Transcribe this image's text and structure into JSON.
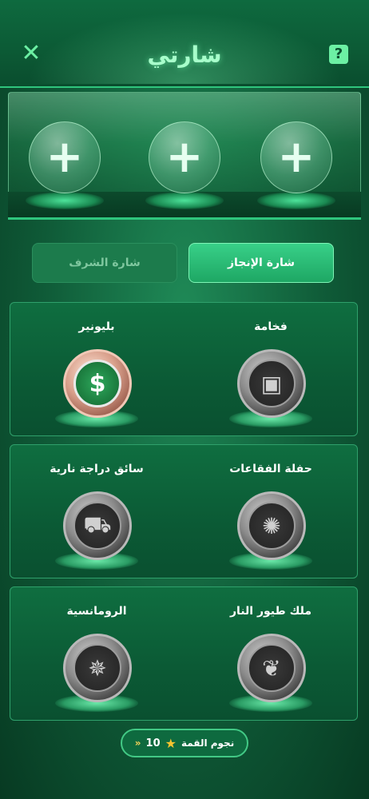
{
  "header": {
    "title": "شارتي",
    "close_icon": "✕",
    "help_icon": "?"
  },
  "display_slots": [
    {
      "icon": "+"
    },
    {
      "icon": "+"
    },
    {
      "icon": "+"
    }
  ],
  "tabs": [
    {
      "label": "شارة الإنجاز",
      "active": true
    },
    {
      "label": "شارة الشرف",
      "active": false
    }
  ],
  "badges": [
    {
      "name": "فخامة",
      "icon": "treasure-chest-icon",
      "glyph": "▣"
    },
    {
      "name": "بليونير",
      "icon": "dollar-icon",
      "glyph": "$"
    },
    {
      "name": "حفلة الفقاعات",
      "icon": "bubble-gun-icon",
      "glyph": "✺"
    },
    {
      "name": "سائق دراجة نارية",
      "icon": "motorcycle-icon",
      "glyph": "⛟"
    },
    {
      "name": "ملك طيور النار",
      "icon": "phoenix-icon",
      "glyph": "❦"
    },
    {
      "name": "الرومانسية",
      "icon": "ferris-wheel-icon",
      "glyph": "✵"
    }
  ],
  "top_stars": {
    "label": "نجوم القمة",
    "count": "10",
    "chevron": "»"
  },
  "colors": {
    "accent": "#2fc57d",
    "title": "#a8ffcb",
    "background": "#0f5a37"
  }
}
